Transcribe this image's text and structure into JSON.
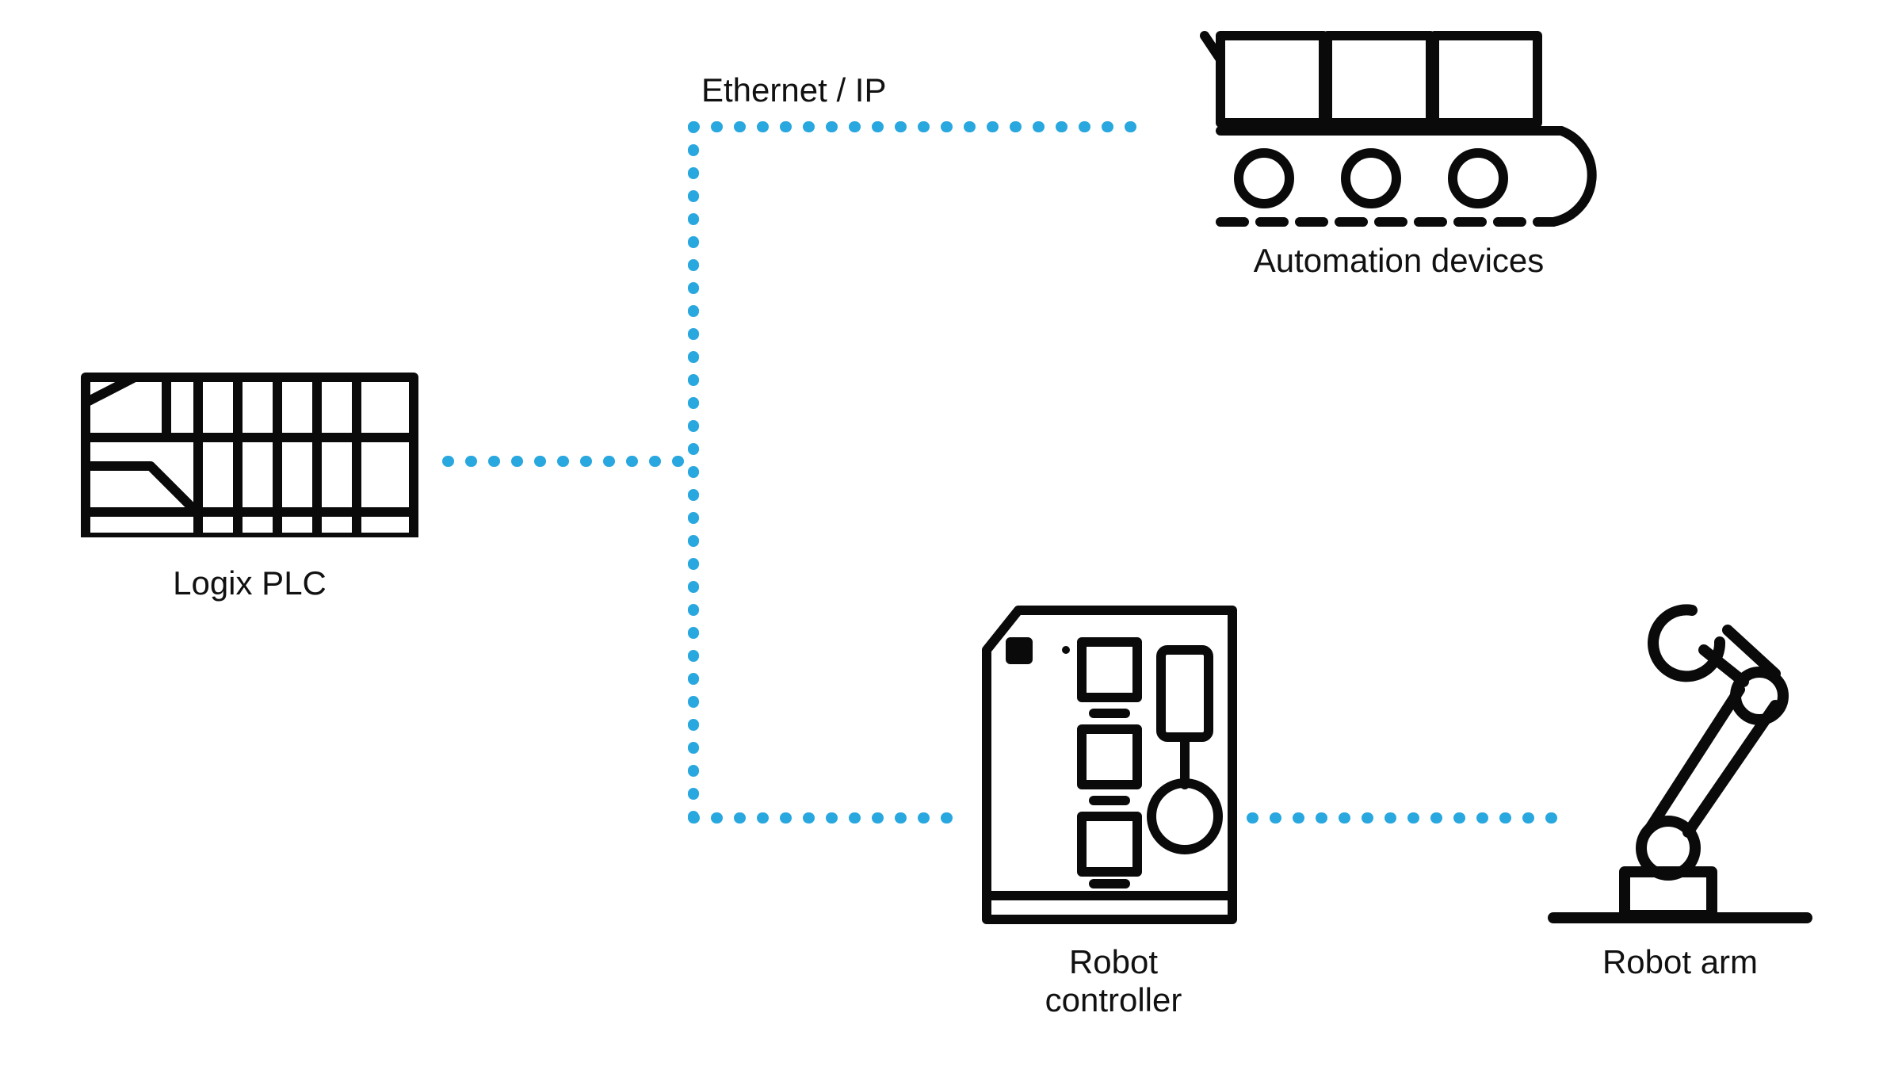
{
  "diagram": {
    "connection_label": "Ethernet / IP",
    "nodes": {
      "plc": {
        "label": "Logix PLC"
      },
      "automation": {
        "label": "Automation devices"
      },
      "controller": {
        "label": "Robot\ncontroller"
      },
      "arm": {
        "label": "Robot arm"
      }
    },
    "colors": {
      "line": "#29a7df",
      "icon": "#0a0a0a"
    }
  }
}
